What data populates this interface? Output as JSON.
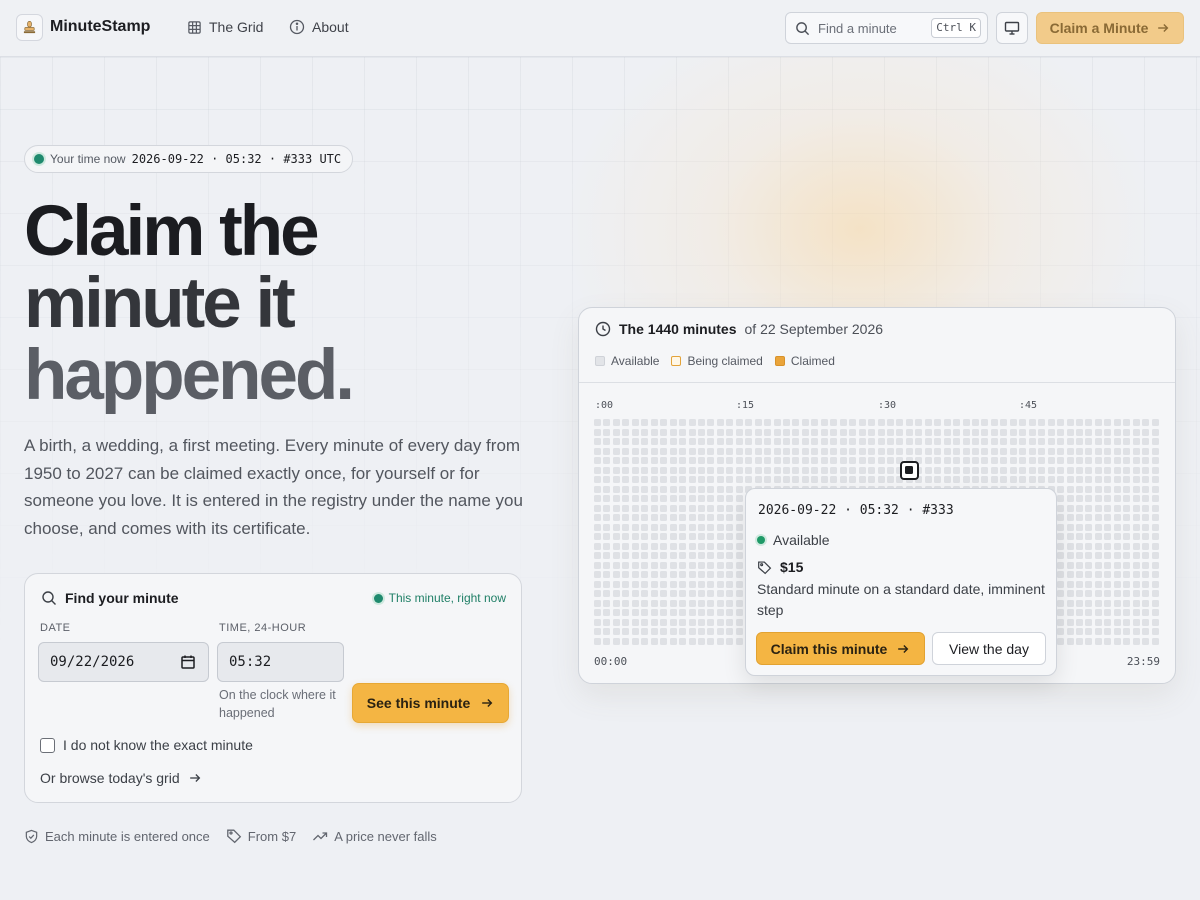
{
  "brand": {
    "name": "MinuteStamp",
    "logo_icon": "stamp-icon"
  },
  "nav": [
    {
      "label": "The Grid",
      "icon": "grid-icon"
    },
    {
      "label": "About",
      "icon": "info-icon"
    }
  ],
  "search": {
    "placeholder": "Find a minute",
    "shortcut": "Ctrl K"
  },
  "header_cta": "Claim a Minute",
  "time_pill": {
    "label": "Your time now",
    "value": "2026-09-22 · 05:32 · #333 UTC"
  },
  "hero": {
    "line1": "Claim the",
    "line2": "minute it",
    "line3": "happened.",
    "description": "A birth, a wedding, a first meeting. Every minute of every day from 1950 to 2027 can be claimed exactly once, for yourself or for someone you love. It is entered in the registry under the name you choose, and comes with its certificate."
  },
  "find": {
    "title": "Find your minute",
    "now_label": "This minute, right now",
    "date_label": "DATE",
    "date_value": "09/22/2026",
    "time_label": "TIME, 24-HOUR",
    "time_value": "05:32",
    "time_hint": "On the clock where it happened",
    "submit": "See this minute",
    "unknown_label": "I do not know the exact minute",
    "browse_label": "Or browse today's grid"
  },
  "features": [
    {
      "icon": "shield-check-icon",
      "label": "Each minute is entered once"
    },
    {
      "icon": "tag-icon",
      "label": "From $7"
    },
    {
      "icon": "trending-up-icon",
      "label": "A price never falls"
    }
  ],
  "grid": {
    "title": "The 1440 minutes",
    "subtitle": "of 22 September 2026",
    "legend": [
      {
        "label": "Available",
        "color": "#e2e4e8",
        "border": "#cfd2d8"
      },
      {
        "label": "Being claimed",
        "color": "#fff7e6",
        "border": "#e3a33a"
      },
      {
        "label": "Claimed",
        "color": "#eaa43a",
        "border": "#d8922a"
      }
    ],
    "ticks": [
      ":00",
      ":15",
      ":30",
      ":45"
    ],
    "start_label": "00:00",
    "end_label": "23:59",
    "columns": 60,
    "rows": 24,
    "selected_minute": 333,
    "cell_color": "#dfe1e5"
  },
  "popover": {
    "title": "2026-09-22 · 05:32 · #333",
    "status": "Available",
    "price": "$15",
    "description": "Standard minute on a standard date, imminent step",
    "claim": "Claim this minute",
    "view": "View the day"
  }
}
